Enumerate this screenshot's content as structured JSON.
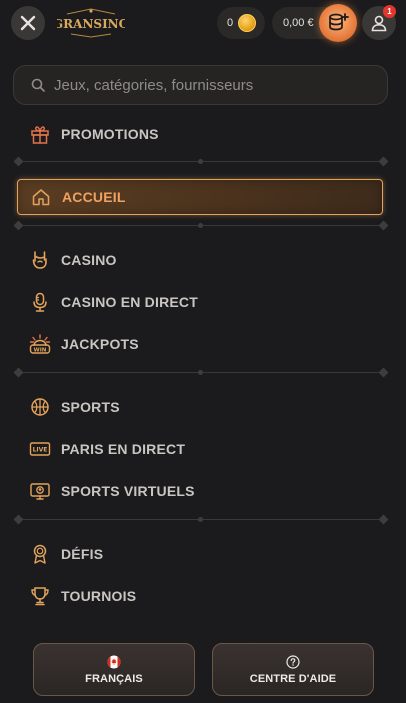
{
  "header": {
    "close_icon": "close-icon",
    "logo_text": "GRANSINO",
    "coins_value": "0",
    "balance_value": "0,00 €",
    "deposit_icon": "coins-plus-icon",
    "profile_icon": "user-icon",
    "notification_count": "1"
  },
  "search": {
    "placeholder": "Jeux, catégories, fournisseurs",
    "icon": "search-icon"
  },
  "menu": {
    "promotions": "PROMOTIONS",
    "accueil": "ACCUEIL",
    "casino": "CASINO",
    "casino_live": "CASINO EN DIRECT",
    "jackpots": "JACKPOTS",
    "sports": "SPORTS",
    "paris_live": "PARIS EN DIRECT",
    "sports_virtuels": "SPORTS VIRTUELS",
    "defis": "DÉFIS",
    "tournois": "TOURNOIS",
    "jackpot_badge": "WIN",
    "live_badge": "LIVE"
  },
  "footer": {
    "language_label": "FRANÇAIS",
    "help_label": "CENTRE D'AIDE"
  },
  "colors": {
    "accent": "#f0a160",
    "background": "#1b1b1d",
    "icon": "#e3a35d"
  }
}
